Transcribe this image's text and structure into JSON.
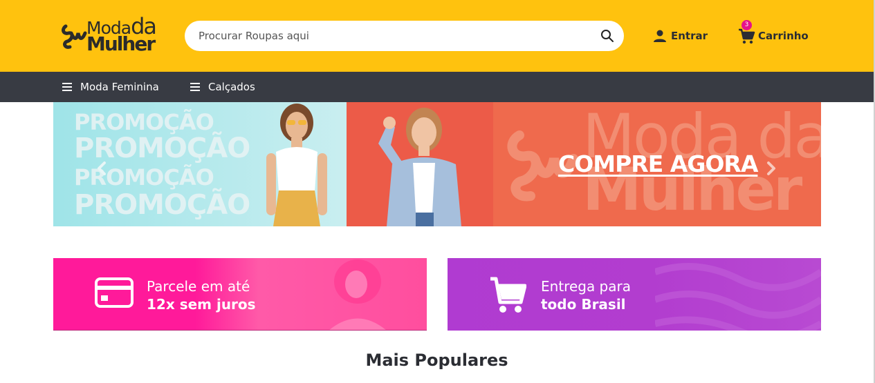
{
  "logo": {
    "line1": "Moda",
    "line1_da": "da",
    "line2": "Mulher"
  },
  "search": {
    "placeholder": "Procurar Roupas aqui",
    "icon": "search-icon"
  },
  "account": {
    "login_label": "Entrar",
    "icon": "user-icon"
  },
  "cart": {
    "label": "Carrinho",
    "count": "3",
    "icon": "cart-icon"
  },
  "nav": {
    "items": [
      {
        "label": "Moda Feminina",
        "icon": "menu-icon"
      },
      {
        "label": "Calçados",
        "icon": "menu-icon"
      }
    ]
  },
  "banner": {
    "promo_words": [
      "PROMOÇÃO",
      "PROMOÇÃO",
      "PROMOÇÃO",
      "PROMOÇÃO"
    ],
    "cta": "COMPRE AGORA",
    "watermark_top": "Moda da",
    "watermark_bottom": "Mulher"
  },
  "features": [
    {
      "line1": "Parcele em até",
      "line2": "12x sem juros",
      "icon": "credit-card-icon"
    },
    {
      "line1": "Entrega para",
      "line2": "todo Brasil",
      "icon": "cart-icon"
    }
  ],
  "section": {
    "title": "Mais Populares"
  },
  "colors": {
    "header": "#ffc20e",
    "nav": "#383b43",
    "badge": "#e5128b",
    "feature_pink": "#ff1a9a",
    "feature_purple": "#b03bd1",
    "banner_coral": "#ef6a4d",
    "banner_aqua": "#a9e6ea"
  }
}
